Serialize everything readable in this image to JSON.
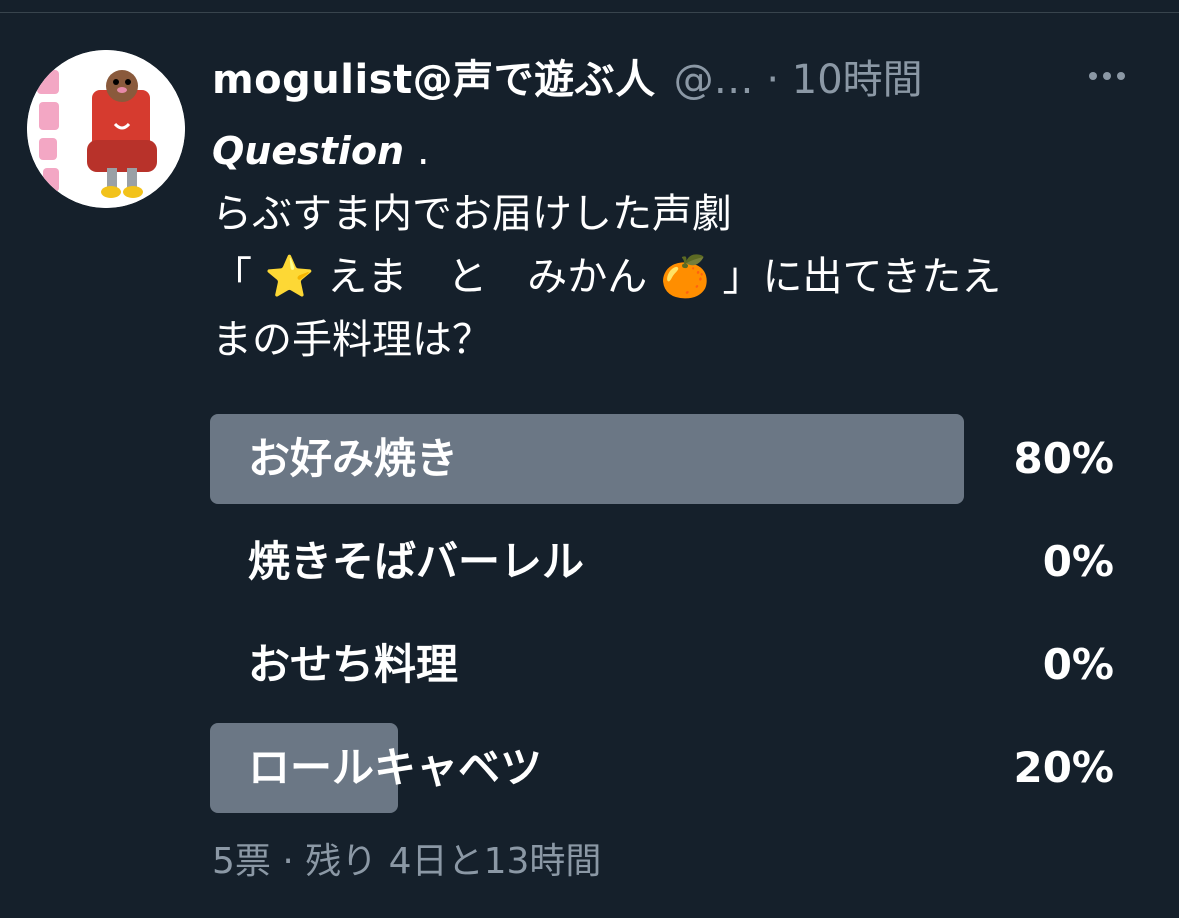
{
  "tweet": {
    "display_name": "mogulist@声で遊ぶ人",
    "handle": "@…",
    "separator": "·",
    "time": "10時間",
    "more_label": "…",
    "lines": {
      "question_title": "Question",
      "question_dot": ".",
      "line2": "らぶすま内でお届けした声劇",
      "line3_open": "「",
      "line3_emoji1": "⭐",
      "line3_mid": "えま　と　みかん",
      "line3_emoji2": "🍊",
      "line3_close": "」に出てきたえ",
      "line4": "まの手料理は？"
    }
  },
  "poll": {
    "options": [
      {
        "label": "お好み焼き",
        "percent_text": "80%",
        "value": 0.8
      },
      {
        "label": "焼きそばバーレル",
        "percent_text": "0%",
        "value": 0.0
      },
      {
        "label": "おせち料理",
        "percent_text": "0%",
        "value": 0.0
      },
      {
        "label": "ロールキャベツ",
        "percent_text": "20%",
        "value": 0.2
      }
    ],
    "footer": "5票 · 残り 4日と13時間"
  },
  "avatar": {
    "icon": "mole-character-avatar"
  },
  "colors": {
    "background": "#15202b",
    "bar_fill": "#6b7785",
    "secondary_text": "#8b98a5",
    "primary_text": "#ffffff"
  }
}
